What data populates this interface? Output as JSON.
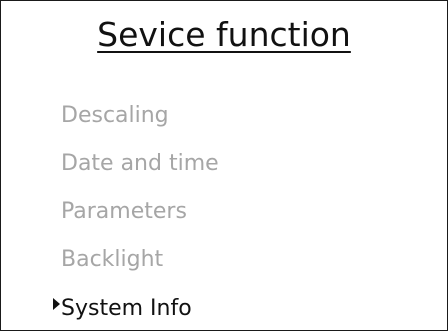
{
  "title": "Sevice function",
  "menu": {
    "items": [
      {
        "label": "Descaling",
        "selected": false
      },
      {
        "label": "Date and time",
        "selected": false
      },
      {
        "label": "Parameters",
        "selected": false
      },
      {
        "label": "Backlight",
        "selected": false
      },
      {
        "label": "System Info",
        "selected": true
      }
    ]
  },
  "colors": {
    "text_active": "#111111",
    "text_inactive": "#a6a6a6",
    "border": "#1a1a1a",
    "background": "#ffffff"
  },
  "icons": {
    "cursor": "selection-cursor-icon"
  }
}
